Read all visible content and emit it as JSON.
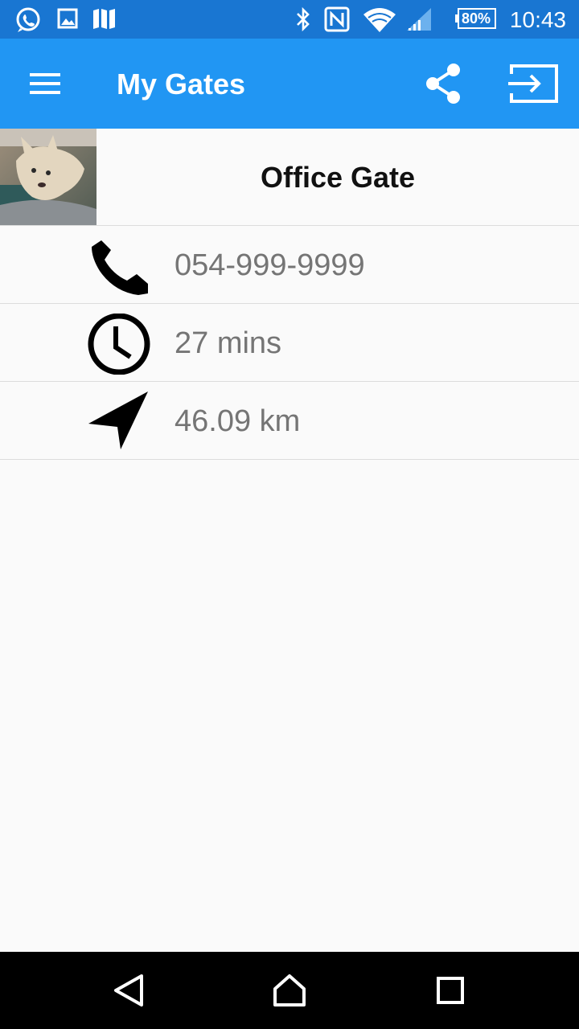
{
  "status_bar": {
    "time": "10:43",
    "battery": "80%",
    "icons": [
      "whatsapp-icon",
      "gallery-icon",
      "wallet-icon",
      "bluetooth-icon",
      "nfc-icon",
      "wifi-icon",
      "signal-icon",
      "battery-icon"
    ]
  },
  "app_bar": {
    "title": "My Gates",
    "color": "#2196f3",
    "status_color": "#1976d2",
    "icons": [
      "menu-icon",
      "share-icon",
      "logout-icon"
    ]
  },
  "gate": {
    "name": "Office Gate",
    "details": [
      {
        "icon": "phone-icon",
        "text": "054-999-9999"
      },
      {
        "icon": "clock-icon",
        "text": "27 mins"
      },
      {
        "icon": "navigation-icon",
        "text": "46.09 km"
      }
    ]
  },
  "nav_bar": {
    "icons": [
      "back-icon",
      "home-icon",
      "recents-icon"
    ]
  }
}
